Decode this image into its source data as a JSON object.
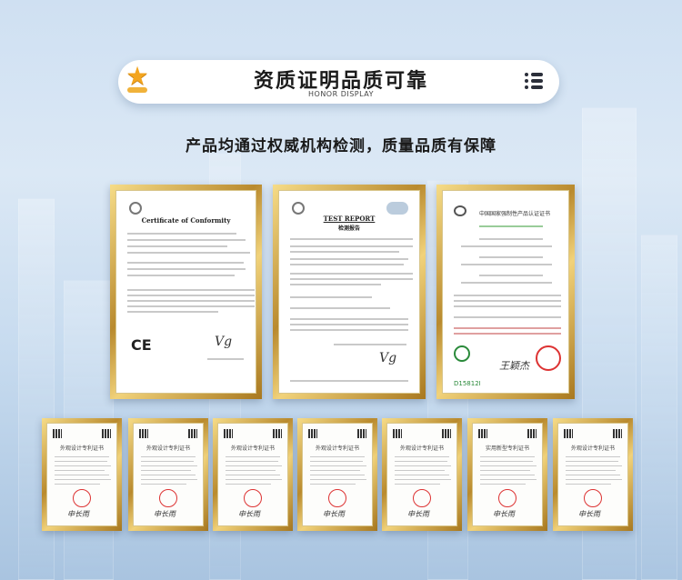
{
  "header": {
    "title": "资质证明品质可靠",
    "subtitle": "HONOR DISPLAY",
    "star_icon": "star-icon",
    "menu_icon": "dots-menu-icon"
  },
  "headline": "产品均通过权威机构检测，质量品质有保障",
  "certificates": {
    "ce": {
      "title": "Certificate of Conformity",
      "mark": "CE"
    },
    "report": {
      "title": "TEST REPORT",
      "subtitle": "检测报告"
    },
    "ccc": {
      "title": "中国国家强制性产品认证证书",
      "code": "D15812I"
    }
  },
  "patents": [
    {
      "title": "外观设计专利证书"
    },
    {
      "title": "外观设计专利证书"
    },
    {
      "title": "外观设计专利证书"
    },
    {
      "title": "外观设计专利证书"
    },
    {
      "title": "外观设计专利证书"
    },
    {
      "title": "实用新型专利证书"
    },
    {
      "title": "外观设计专利证书"
    }
  ]
}
